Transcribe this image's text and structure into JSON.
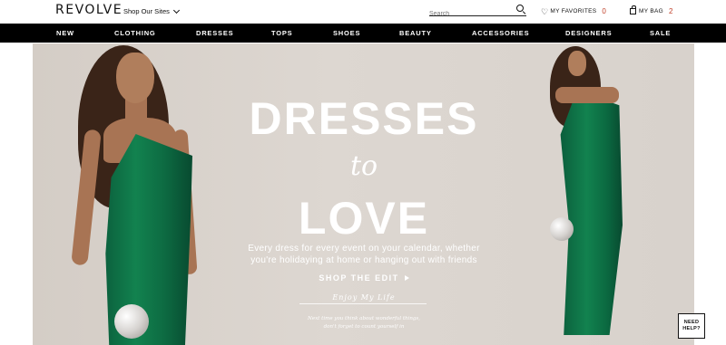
{
  "header": {
    "logo": "REVOLVE",
    "shop_sites": "Shop Our Sites",
    "search_placeholder": "Search",
    "favorites_label": "MY FAVORITES",
    "favorites_count": "0",
    "bag_label": "MY BAG",
    "bag_count": "2"
  },
  "nav": {
    "items": [
      "NEW",
      "CLOTHING",
      "DRESSES",
      "TOPS",
      "SHOES",
      "BEAUTY",
      "ACCESSORIES",
      "DESIGNERS",
      "SALE"
    ]
  },
  "hero": {
    "title_1": "DRESSES",
    "title_2": "to",
    "title_3": "LOVE",
    "subtitle_1": "Every dress for every event on your calendar, whether",
    "subtitle_2": "you're holidaying at home or hanging out with friends",
    "cta": "SHOP THE EDIT",
    "script_1": "Enjoy My Life",
    "script_2": "Next time you think about wonderful things,",
    "script_3": "don't forget to count yourself in"
  },
  "help": {
    "line_1": "NEED",
    "line_2": "HELP?"
  },
  "colors": {
    "nav_bg": "#000000",
    "count_accent": "#c0412b",
    "hero_bg": "#d9d3cd",
    "dress_green": "#0d6b42"
  }
}
